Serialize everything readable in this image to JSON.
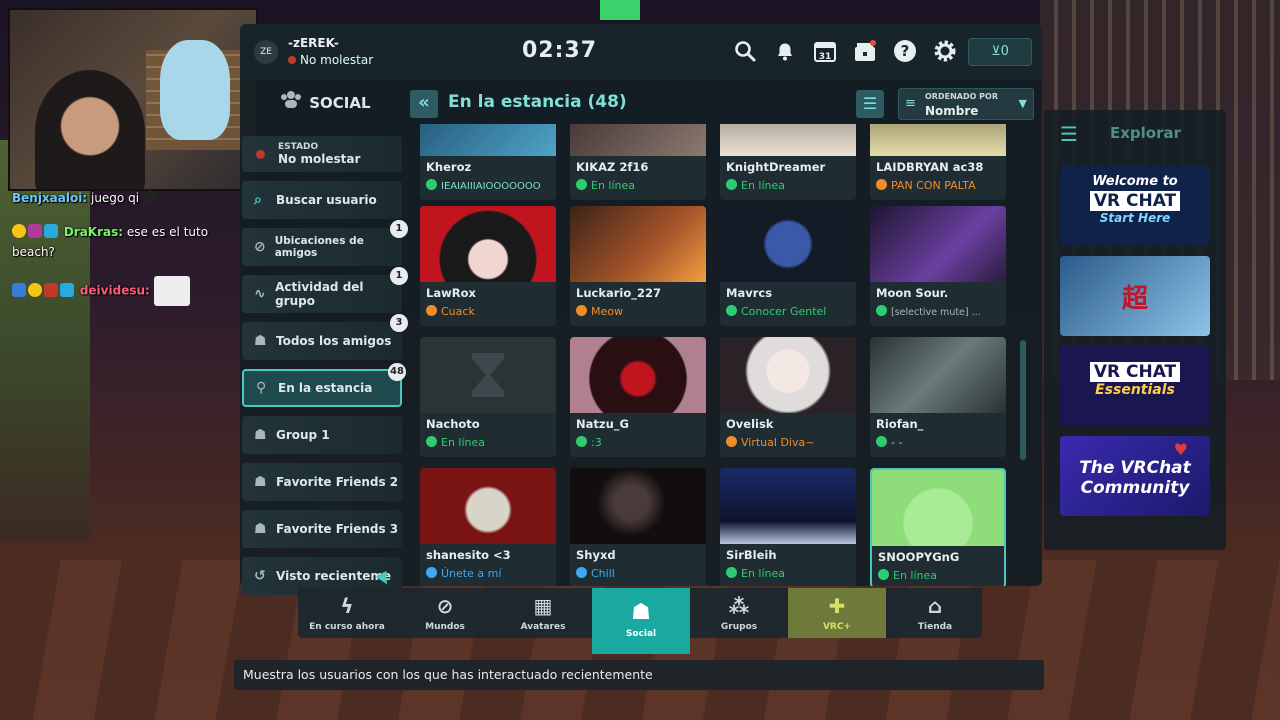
{
  "chat": [
    {
      "user": "Benjxaaloi:",
      "text": "juego qi",
      "user_color": "#6fc6ff"
    },
    {
      "user": "DraKras:",
      "text": "ese es el tuto beach?",
      "user_color": "#7cf26b"
    },
    {
      "user": "deividesu:",
      "text": "",
      "user_color": "#ff5c7a"
    }
  ],
  "user": {
    "initials": "ZE",
    "name": "-zEREK-",
    "status": "No molestar"
  },
  "clock": "02:37",
  "credits": "⊻0",
  "social": {
    "header": "SOCIAL",
    "state_label": "ESTADO",
    "state_value": "No molestar",
    "items": [
      {
        "label": "Buscar usuario",
        "icon": "search-icon",
        "count": ""
      },
      {
        "label": "Ubicaciones de amigos",
        "icon": "globe-icon",
        "count": "1"
      },
      {
        "label": "Actividad del grupo",
        "icon": "activity-icon",
        "count": "1"
      },
      {
        "label": "Todos los amigos",
        "icon": "friends-icon",
        "count": "3"
      },
      {
        "label": "En la estancia",
        "icon": "location-icon",
        "count": "48"
      },
      {
        "label": "Group 1",
        "icon": "group-icon",
        "count": ""
      },
      {
        "label": "Favorite Friends 2",
        "icon": "group-icon",
        "count": ""
      },
      {
        "label": "Favorite Friends 3",
        "icon": "group-icon",
        "count": ""
      },
      {
        "label": "Visto recienteme",
        "icon": "history-icon",
        "count": ""
      }
    ]
  },
  "content": {
    "title": "En la estancia (48)",
    "sort_label": "ORDENADO POR",
    "sort_value": "Nombre"
  },
  "users": [
    {
      "name": "Kheroz",
      "status": "IEAIAIIIAIOOOOOOO",
      "status_color": "#2ecc71",
      "thumb": "#1d4e6b"
    },
    {
      "name": "KIKAZ 2f16",
      "status": "En línea",
      "status_color": "#2ecc71",
      "thumb": "#4a3a3a"
    },
    {
      "name": "KnightDreamer",
      "status": "En línea",
      "status_color": "#2ecc71",
      "thumb": "#d8cfc0"
    },
    {
      "name": "LAIDBRYAN ac38",
      "status": "PAN CON PALTA",
      "status_color": "#f28c28",
      "thumb": "#cfc79a"
    },
    {
      "name": "LawRox",
      "status": "Cuack",
      "status_color": "#f28c28",
      "thumb": "#9e1b22"
    },
    {
      "name": "Luckario_227",
      "status": "Meow",
      "status_color": "#f28c28",
      "thumb": "#6a3d24"
    },
    {
      "name": "Mavrcs",
      "status": "Conocer Gentel",
      "status_color": "#2ecc71",
      "thumb": "#23304a"
    },
    {
      "name": "Moon Sour.",
      "status": "[selective mute] ...",
      "status_color": "#2ecc71",
      "thumb": "#3d2a55"
    },
    {
      "name": "Nachoto",
      "status": "En línea",
      "status_color": "#2ecc71",
      "thumb": "#2a3236"
    },
    {
      "name": "Natzu_G",
      "status": ":3",
      "status_color": "#2ecc71",
      "thumb": "#5a1e22"
    },
    {
      "name": "Ovelisk",
      "status": "Virtual Diva~",
      "status_color": "#f28c28",
      "thumb": "#e6e2e0"
    },
    {
      "name": "Riofan_",
      "status": "- -",
      "status_color": "#2ecc71",
      "thumb": "#3c4a4a"
    },
    {
      "name": "shanesito <3",
      "status": "Únete a mí",
      "status_color": "#3fa9f5",
      "thumb": "#7a1a1a"
    },
    {
      "name": "Shyxd",
      "status": "Chill",
      "status_color": "#3fa9f5",
      "thumb": "#1e1a1c"
    },
    {
      "name": "SirBleih",
      "status": "En línea",
      "status_color": "#2ecc71",
      "thumb": "#1a2a55"
    },
    {
      "name": "SNOOPYGnG",
      "status": "En línea",
      "status_color": "#2ecc71",
      "thumb": "#8edc7a"
    }
  ],
  "explore": {
    "title": "Explorar",
    "tiles": [
      {
        "line1": "Welcome to",
        "line2": "VR CHAT",
        "line3": "Start Here",
        "bg": "#10214a",
        "accent": "#7fd8ff"
      },
      {
        "line1": "",
        "line2": "超",
        "line3": "",
        "bg": "#3a6fa8",
        "accent": "#ffffff"
      },
      {
        "line1": "",
        "line2": "VR CHAT",
        "line3": "Essentials",
        "bg": "#1a1650",
        "accent": "#ffd04a"
      },
      {
        "line1": "The VRChat",
        "line2": "Community",
        "line3": "",
        "bg": "#2a2a9a",
        "accent": "#ffffff"
      }
    ]
  },
  "tabs": [
    {
      "label": "En curso ahora",
      "icon": "lightning-icon"
    },
    {
      "label": "Mundos",
      "icon": "planet-icon"
    },
    {
      "label": "Avatares",
      "icon": "avatar-icon"
    },
    {
      "label": "Social",
      "icon": "social-icon"
    },
    {
      "label": "Grupos",
      "icon": "groups-icon"
    },
    {
      "label": "VRC+",
      "icon": "vrcplus-icon"
    },
    {
      "label": "Tienda",
      "icon": "store-icon"
    }
  ],
  "tooltip": "Muestra los usuarios con los que has interactuado recientemente"
}
